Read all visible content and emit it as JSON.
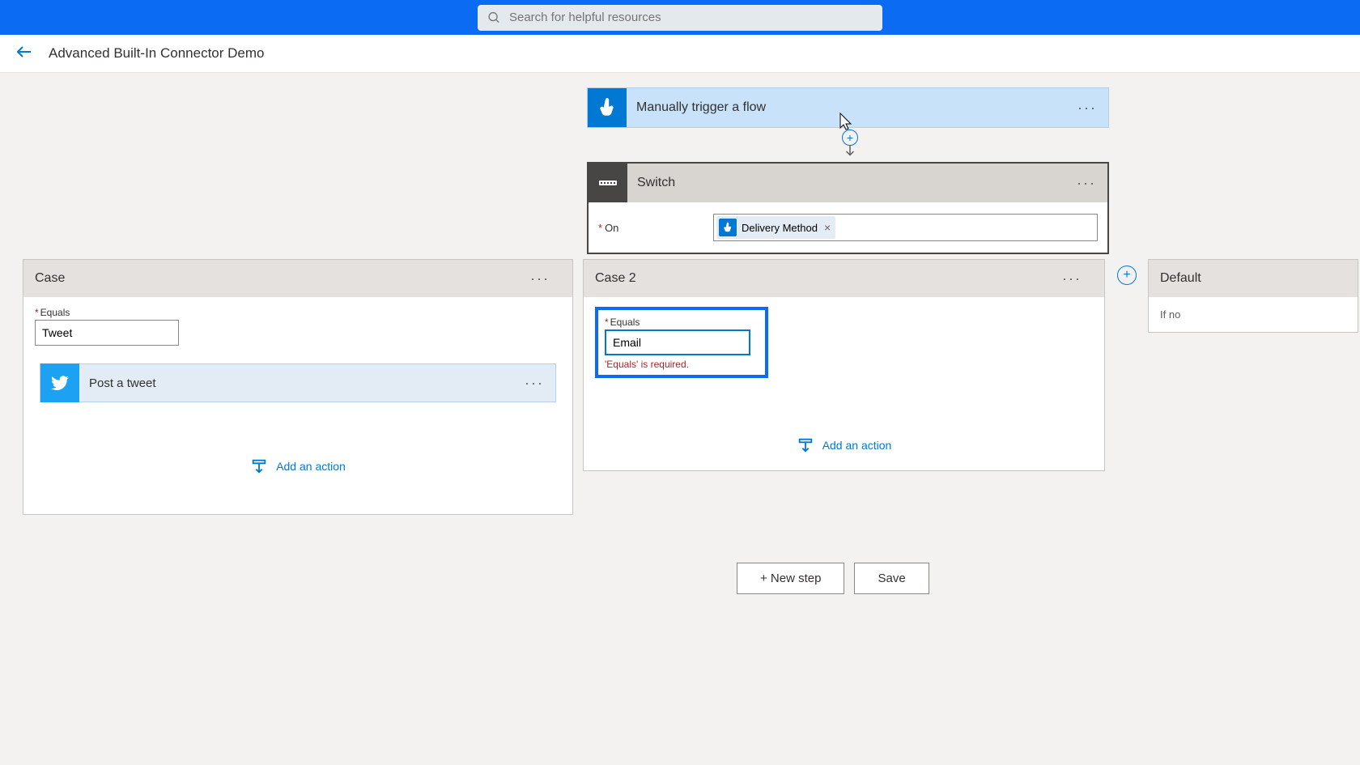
{
  "search": {
    "placeholder": "Search for helpful resources"
  },
  "breadcrumb": {
    "title": "Advanced Built-In Connector Demo"
  },
  "trigger": {
    "title": "Manually trigger a flow"
  },
  "switch": {
    "title": "Switch",
    "on_label": "On",
    "token": {
      "label": "Delivery Method"
    }
  },
  "case1": {
    "title": "Case",
    "equals_label": "Equals",
    "equals_value": "Tweet",
    "action": {
      "title": "Post a tweet"
    },
    "add_action": "Add an action"
  },
  "case2": {
    "title": "Case 2",
    "equals_label": "Equals",
    "equals_value": "Email",
    "validation": "'Equals' is required.",
    "add_action": "Add an action"
  },
  "default": {
    "title": "Default",
    "body": "If no"
  },
  "footer": {
    "new_step": "+ New step",
    "save": "Save"
  }
}
